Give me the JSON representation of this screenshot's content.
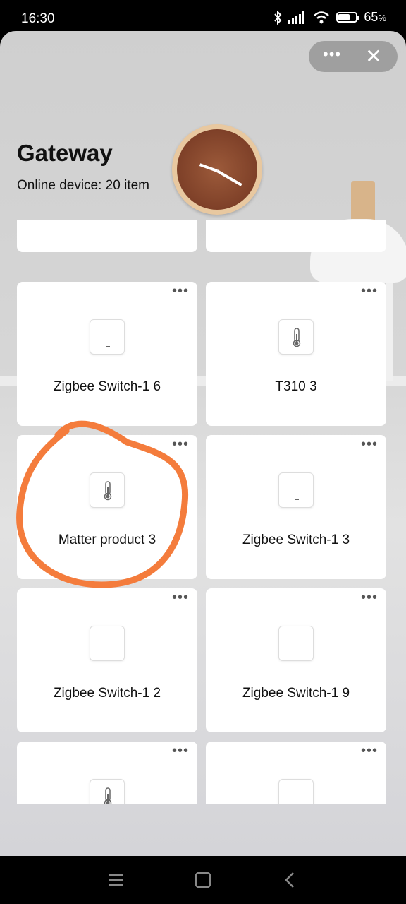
{
  "status_bar": {
    "time": "16:30",
    "battery_level": 0.65,
    "battery_text": "65",
    "battery_unit": "%",
    "icons": [
      "bluetooth-icon",
      "signal-icon",
      "wifi-icon",
      "battery-icon"
    ]
  },
  "header_actions": {
    "more_symbol": "•••",
    "close_symbol": "✕"
  },
  "page": {
    "title": "Gateway",
    "online_devices": "Online device: 20 item"
  },
  "devices": [
    {
      "label": "",
      "icon": "switch-icon"
    },
    {
      "label": "",
      "icon": "switch-icon"
    },
    {
      "label": "Zigbee Switch-1 6",
      "icon": "switch-icon"
    },
    {
      "label": "T310 3",
      "icon": "thermometer-icon"
    },
    {
      "label": "Matter product 3",
      "icon": "thermometer-icon"
    },
    {
      "label": "Zigbee Switch-1 3",
      "icon": "switch-icon"
    },
    {
      "label": "Zigbee Switch-1 2",
      "icon": "switch-icon"
    },
    {
      "label": "Zigbee Switch-1 9",
      "icon": "switch-icon"
    },
    {
      "label": "",
      "icon": "thermometer-icon"
    },
    {
      "label": "",
      "icon": "switch-icon"
    }
  ],
  "card_more_symbol": "•••",
  "annotation_color": "#f47c3c",
  "nav_bar": {
    "buttons": [
      "menu-icon",
      "home-icon",
      "back-icon"
    ]
  }
}
